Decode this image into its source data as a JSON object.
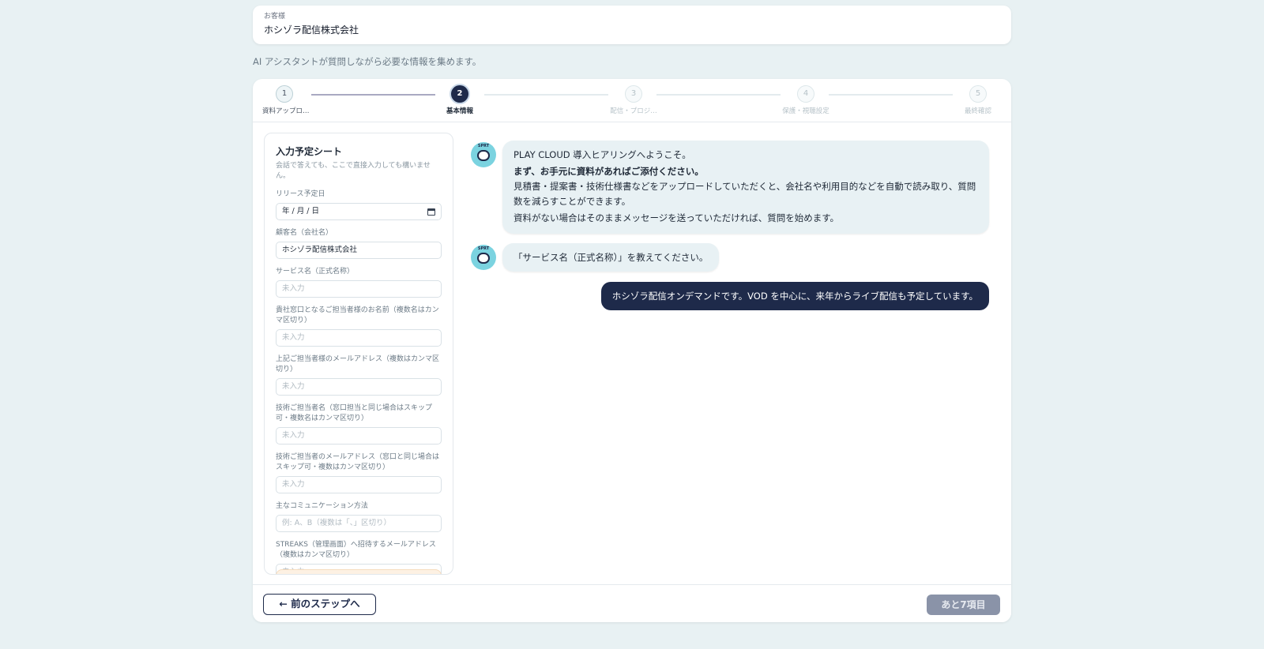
{
  "customer": {
    "label": "お客様",
    "name": "ホシゾラ配信株式会社"
  },
  "intro": "AI アシスタントが質問しながら必要な情報を集めます。",
  "steps": [
    {
      "num": "1",
      "label": "資料アップロ…",
      "state": "done"
    },
    {
      "num": "2",
      "label": "基本情報",
      "state": "active"
    },
    {
      "num": "3",
      "label": "配信・プロジ…",
      "state": "todo"
    },
    {
      "num": "4",
      "label": "保護・視聴設定",
      "state": "todo"
    },
    {
      "num": "5",
      "label": "最終確認",
      "state": "todo"
    }
  ],
  "sheet": {
    "title": "入力予定シート",
    "subtitle": "会話で答えても、ここで直接入力しても構いません。",
    "fields": [
      {
        "label": "リリース予定日",
        "value": "年 / 月 / 日",
        "type": "date"
      },
      {
        "label": "顧客名（会社名）",
        "value": "ホシゾラ配信株式会社"
      },
      {
        "label": "サービス名（正式名称）",
        "placeholder": "未入力"
      },
      {
        "label": "貴社窓口となるご担当者様のお名前（複数名はカンマ区切り）",
        "placeholder": "未入力"
      },
      {
        "label": "上記ご担当者様のメールアドレス（複数はカンマ区切り）",
        "placeholder": "未入力"
      },
      {
        "label": "技術ご担当者名（窓口担当と同じ場合はスキップ可・複数名はカンマ区切り）",
        "placeholder": "未入力"
      },
      {
        "label": "技術ご担当者のメールアドレス（窓口と同じ場合はスキップ可・複数はカンマ区切り）",
        "placeholder": "未入力"
      },
      {
        "label": "主なコミュニケーション方法",
        "placeholder": "例: A、B（複数は「、」区切り）"
      },
      {
        "label": "STREAKS（管理画面）へ招待するメールアドレス（複数はカンマ区切り）",
        "placeholder": "未入力"
      }
    ]
  },
  "chat": {
    "avatar_text": "SPRT",
    "messages": [
      {
        "role": "bot",
        "lines": [
          "PLAY CLOUD 導入ヒアリングへようこそ。",
          "まず、お手元に資料があればご添付ください。",
          "見積書・提案書・技術仕様書などをアップロードしていただくと、会社名や利用目的などを自動で読み取り、質問数を減らすことができます。",
          "資料がない場合はそのままメッセージを送っていただければ、質問を始めます。"
        ]
      },
      {
        "role": "bot",
        "lines": [
          "「サービス名（正式名称）」を教えてください。"
        ]
      },
      {
        "role": "user",
        "text": "ホシゾラ配信オンデマンドです。VOD を中心に、来年からライブ配信も予定しています。"
      }
    ]
  },
  "footer": {
    "back_label": "← 前のステップへ",
    "next_label": "あと7項目"
  }
}
